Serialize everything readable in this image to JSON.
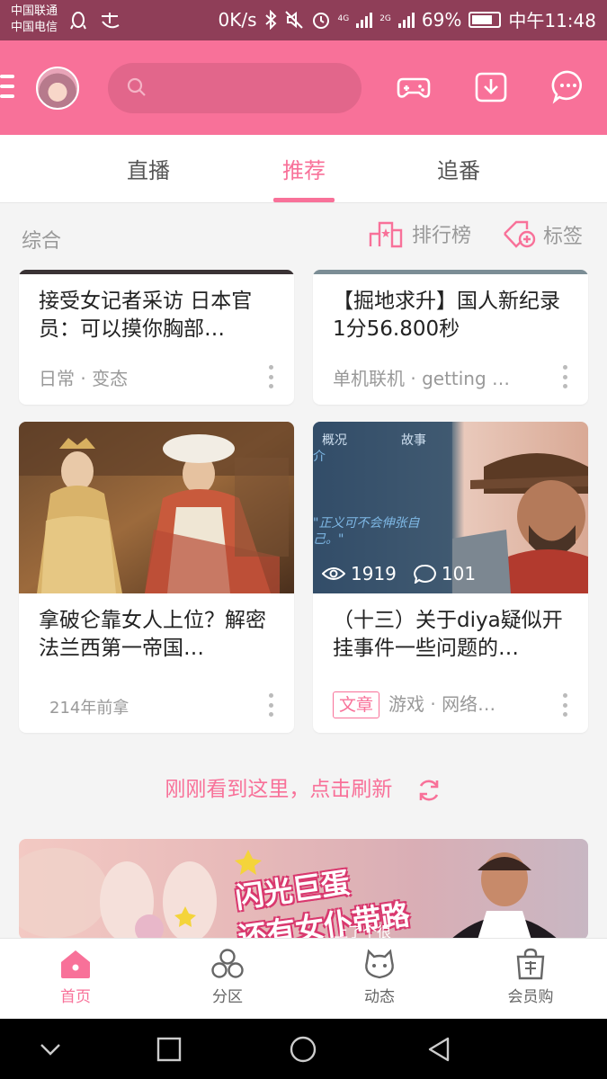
{
  "status_bar": {
    "carrier_1": "中国联通",
    "carrier_2": "中国电信",
    "net_speed": "0K/s",
    "network_4g": "4G",
    "network_2g": "2G",
    "battery": "69%",
    "battery_level": 0.69,
    "time": "中午11:48"
  },
  "header": {
    "search_placeholder": "",
    "icons": [
      "menu-icon",
      "avatar",
      "search-icon",
      "game-controller-icon",
      "download-icon",
      "message-icon"
    ]
  },
  "tabs": [
    {
      "label": "直播",
      "active": false
    },
    {
      "label": "推荐",
      "active": true
    },
    {
      "label": "追番",
      "active": false
    }
  ],
  "section": {
    "title": "综合",
    "rank_label": "排行榜",
    "tag_label": "标签"
  },
  "cards": [
    {
      "title": "接受女记者采访 日本官员：可以摸你胸部…",
      "meta": "日常 · 变态"
    },
    {
      "title": "【掘地求升】国人新纪录 1分56.800秒",
      "meta": "单机联机 · getting …"
    },
    {
      "title": "拿破仑靠女人上位？解密法兰西第一帝国…",
      "meta": "214年前拿"
    },
    {
      "title": "（十三）关于diya疑似开挂事件一些问题的…",
      "badge": "文章",
      "meta": "游戏 · 网络…",
      "views": "1919",
      "comments": "101",
      "overlay_text": {
        "tab1": "概况",
        "tab2": "故事",
        "intro": "介",
        "quote": "\"正义可不会伸张自",
        "quote2": "己。\""
      }
    }
  ],
  "refresh_text": "刚刚看到这里，点击刷新",
  "banner": {
    "line1": "闪光巨蛋",
    "line2": "还有女仆带路",
    "sub": "上了个很"
  },
  "bottom_nav": [
    {
      "label": "首页",
      "active": true
    },
    {
      "label": "分区",
      "active": false
    },
    {
      "label": "动态",
      "active": false
    },
    {
      "label": "会员购",
      "active": false
    }
  ],
  "colors": {
    "accent": "#f87199",
    "status_bar": "#8f3e58",
    "header": "#f87199"
  }
}
